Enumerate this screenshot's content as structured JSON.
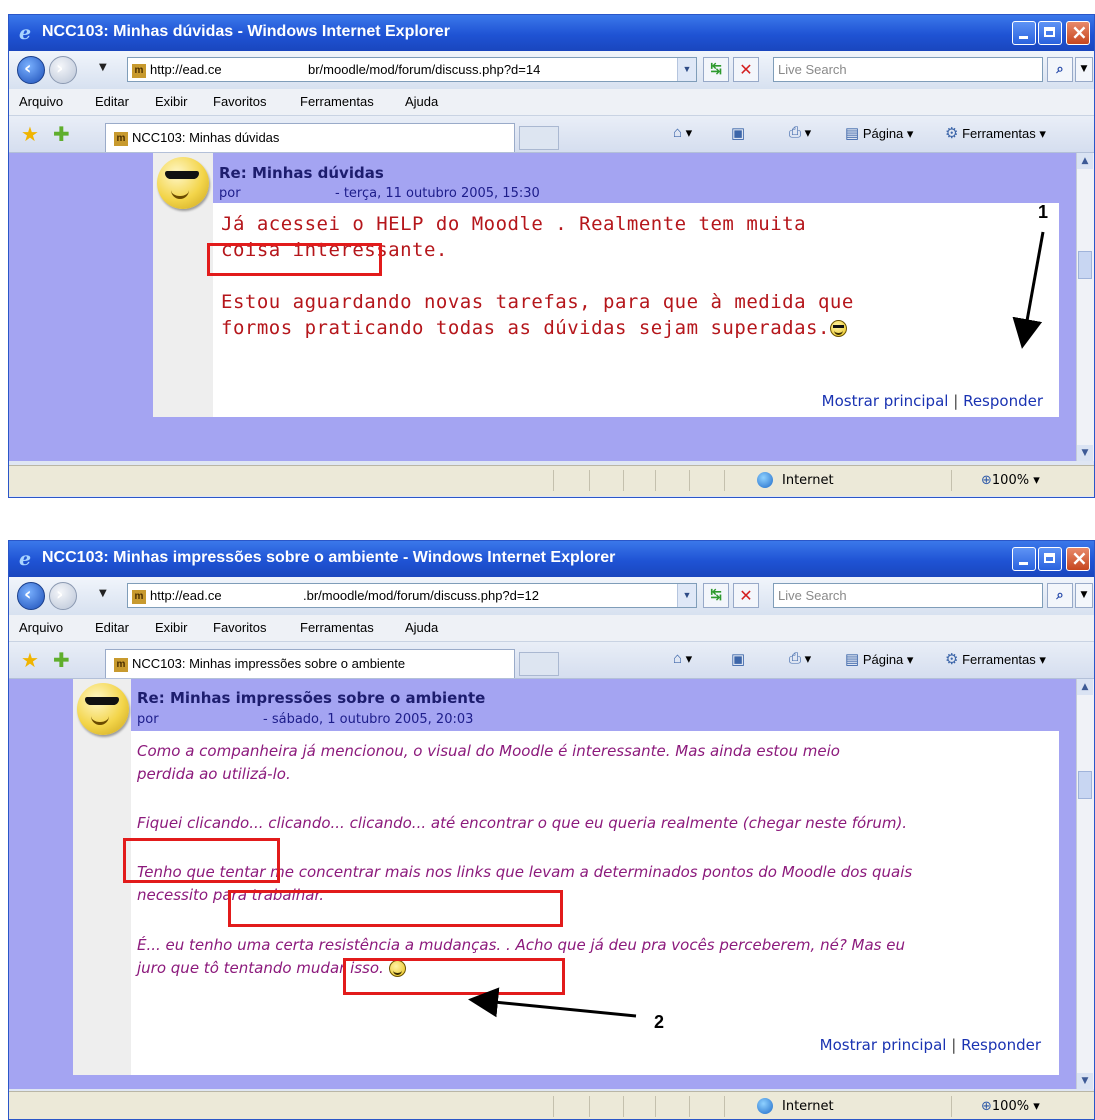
{
  "windows": [
    {
      "title": "NCC103: Minhas dúvidas - Windows Internet Explorer",
      "url_prefix": "http://ead.ce",
      "url_suffix": "br/moodle/mod/forum/discuss.php?d=14",
      "search_placeholder": "Live Search",
      "menu": [
        "Arquivo",
        "Editar",
        "Exibir",
        "Favoritos",
        "Ferramentas",
        "Ajuda"
      ],
      "tab_label": "NCC103: Minhas dúvidas",
      "tools": {
        "page": "Página",
        "tools": "Ferramentas"
      },
      "post": {
        "subject": "Re: Minhas dúvidas",
        "by": "por",
        "date": "- terça, 11 outubro 2005, 15:30",
        "lines": [
          "Já acessei o HELP do Moodle       . Realmente tem muita",
          "coisa interessante.",
          "Estou aguardando novas tarefas, para que à medida que",
          "formos praticando todas as dúvidas sejam superadas."
        ],
        "show_parent": "Mostrar principal",
        "separator": "|",
        "reply": "Responder"
      },
      "status": {
        "zone": "Internet",
        "zoom": "100%"
      }
    },
    {
      "title": "NCC103: Minhas impressões sobre o ambiente - Windows Internet Explorer",
      "url_prefix": "http://ead.ce",
      "url_suffix": ".br/moodle/mod/forum/discuss.php?d=12",
      "search_placeholder": "Live Search",
      "menu": [
        "Arquivo",
        "Editar",
        "Exibir",
        "Favoritos",
        "Ferramentas",
        "Ajuda"
      ],
      "tab_label": "NCC103: Minhas impressões sobre o ambiente",
      "tools": {
        "page": "Página",
        "tools": "Ferramentas"
      },
      "post": {
        "subject": "Re: Minhas impressões sobre o ambiente",
        "by": "por",
        "date": "- sábado, 1 outubro 2005, 20:03",
        "lines": [
          "Como a companheira              já mencionou, o visual do Moodle é interessante. Mas ainda estou meio",
          "perdida ao utilizá-lo.",
          "Fiquei clicando...  clicando...  clicando... até encontrar o que eu queria realmente (chegar neste fórum).",
          "Tenho que tentar me concentrar mais nos links que levam a determinados pontos do Moodle dos quais",
          "necessito para trabalhar.",
          "É... eu tenho uma certa resistência a mudanças. . Acho que já deu pra vocês perceberem, né? Mas eu",
          "juro que tô tentando mudar isso."
        ],
        "show_parent": "Mostrar principal",
        "separator": "|",
        "reply": "Responder"
      },
      "status": {
        "zone": "Internet",
        "zoom": "100%"
      }
    }
  ],
  "callouts": [
    "1",
    "2"
  ],
  "colors": {
    "highlight_box": "#e21b1b",
    "page_bg": "#a4a4f2",
    "post_text_1": "#b5161b",
    "post_text_2": "#8c1a7c"
  },
  "icons": [
    "ie-logo-icon",
    "back-icon",
    "forward-icon",
    "refresh-icon",
    "stop-icon",
    "search-icon",
    "favorites-star-icon",
    "add-favorites-icon",
    "home-icon",
    "feeds-icon",
    "print-icon",
    "page-icon",
    "tools-gear-icon",
    "globe-icon",
    "zoom-icon",
    "smiley-icon"
  ]
}
